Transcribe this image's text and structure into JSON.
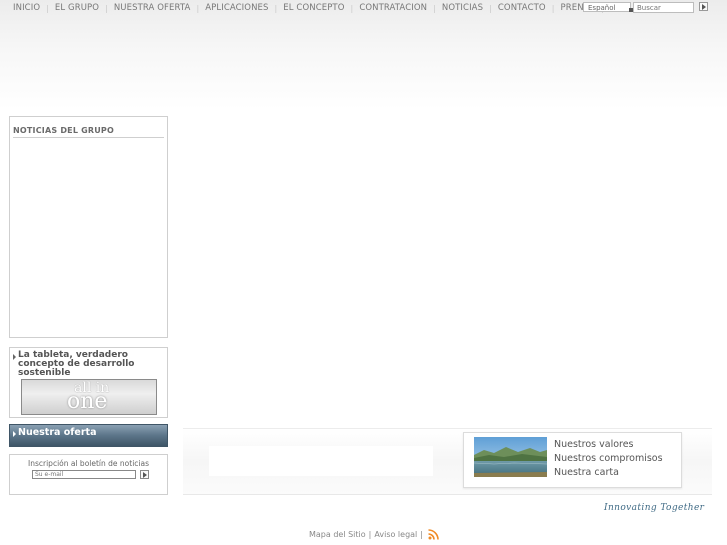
{
  "nav": {
    "items": [
      {
        "label": "INICIO"
      },
      {
        "label": "EL GRUPO"
      },
      {
        "label": "NUESTRA OFERTA"
      },
      {
        "label": "APLICACIONES"
      },
      {
        "label": "EL CONCEPTO"
      },
      {
        "label": "CONTRATACION"
      },
      {
        "label": "NOTICIAS"
      },
      {
        "label": "CONTACTO"
      },
      {
        "label": "PRENSA"
      }
    ]
  },
  "language": {
    "selected": "Español"
  },
  "search": {
    "placeholder": "Buscar"
  },
  "sidebar": {
    "news_title": "NOTICIAS DEL GRUPO",
    "promo_title": "La tableta, verdadero concepto de desarrollo sostenible",
    "promo_image_text_top": "all in",
    "promo_image_text_bottom": "one",
    "offer_label": "Nuestra oferta",
    "newsletter_label": "Inscripción al boletín de noticias",
    "newsletter_placeholder": "Su e-mail"
  },
  "values": {
    "links": [
      {
        "label": "Nuestros valores"
      },
      {
        "label": "Nuestros compromisos"
      },
      {
        "label": "Nuestra carta"
      }
    ]
  },
  "tagline": "Innovating Together",
  "footer": {
    "sitemap": "Mapa del Sitio",
    "legal": "Aviso legal",
    "separator": "|"
  },
  "colors": {
    "offer_bar": "#5c7589",
    "tagline": "#3f6a85",
    "rss": "#f08a24"
  }
}
